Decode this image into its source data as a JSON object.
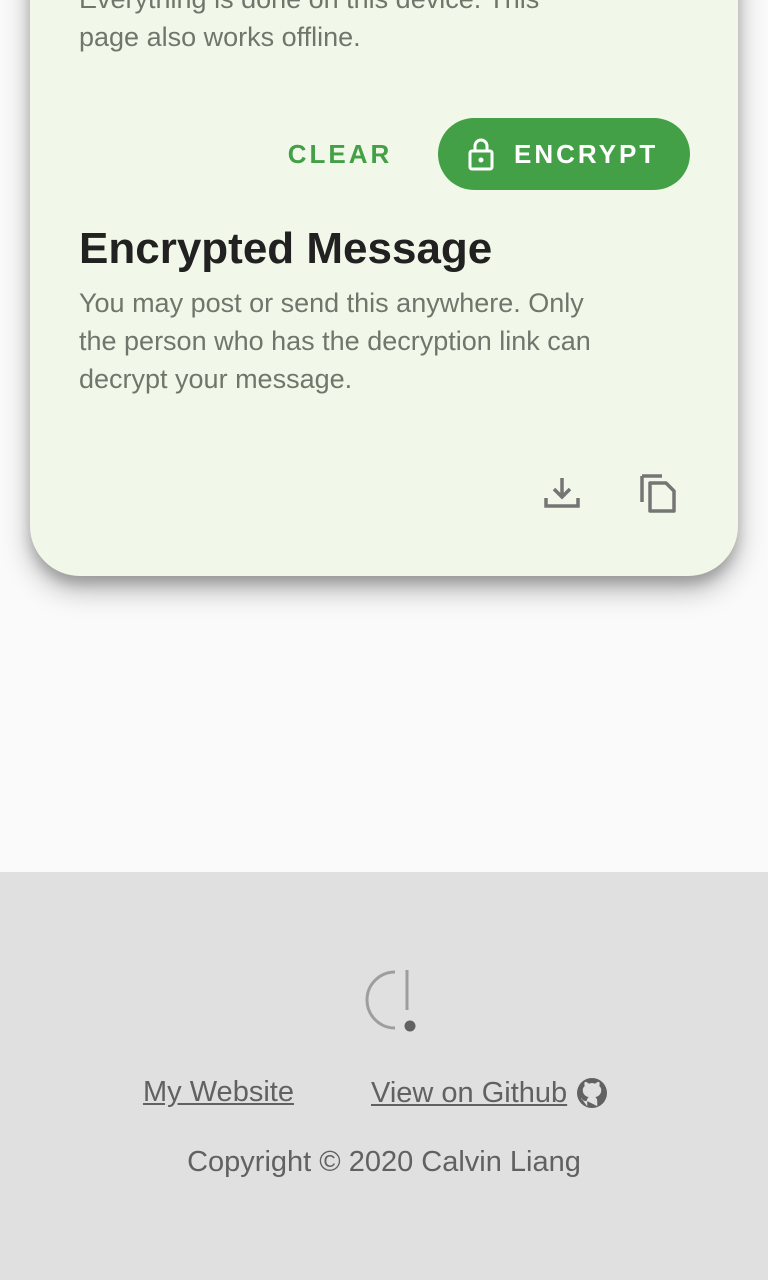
{
  "card": {
    "intro_lines": [
      "Everything is done on this device. This",
      "page also works offline."
    ],
    "actions": {
      "clear_label": "CLEAR",
      "encrypt_label": "ENCRYPT",
      "encrypt_icon": "lock-icon"
    },
    "result": {
      "title": "Encrypted Message",
      "description_lines": [
        "You may post or send this anywhere. Only",
        "the person who has the decryption link can",
        "decrypt your message."
      ],
      "download_icon": "download-icon",
      "copy_icon": "copy-icon"
    }
  },
  "footer": {
    "logo_icon": "logo-icon",
    "links": {
      "website": "My Website",
      "github": "View on Github",
      "github_icon": "github-icon"
    },
    "copyright": "Copyright © 2020 Calvin Liang"
  },
  "colors": {
    "accent": "#43a047",
    "card_background": "#f1f8e9",
    "footer_background": "#e0e0e0",
    "page_background": "#fafafa"
  }
}
